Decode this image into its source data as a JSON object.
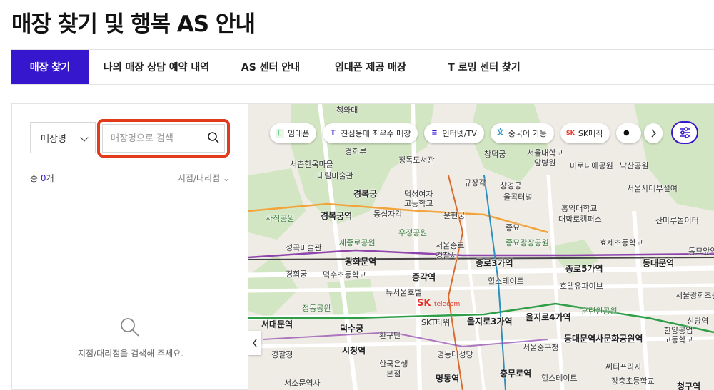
{
  "page": {
    "title": "매장 찾기 및 행복 AS 안내"
  },
  "tabs": [
    {
      "label": "매장 찾기",
      "active": true
    },
    {
      "label": "나의 매장 상담 예약 내역",
      "active": false
    },
    {
      "label": "AS 센터 안내",
      "active": false
    },
    {
      "label": "임대폰 제공 매장",
      "active": false
    },
    {
      "label": "T 로밍 센터 찾기",
      "active": false
    }
  ],
  "search": {
    "select_value": "매장명",
    "placeholder": "매장명으로 검색",
    "count_prefix": "총 ",
    "count_value": "0",
    "count_suffix": "개",
    "sort_label": "지점/대리점",
    "empty_message": "지점/대리점을 검색해 주세요."
  },
  "map": {
    "chips": [
      {
        "label": "임대폰",
        "icon": "phone-icon"
      },
      {
        "label": "진심응대 최우수 매장",
        "icon": "t-brand-icon"
      },
      {
        "label": "인터넷/TV",
        "icon": "tv-icon"
      },
      {
        "label": "중국어 가능",
        "icon": "chinese-char-icon"
      },
      {
        "label": "SK매직",
        "icon": "sk-logo-icon"
      },
      {
        "label": "",
        "icon": "apple-icon"
      }
    ],
    "skt_logo": {
      "text": "SK",
      "sub": "telecom"
    },
    "labels": [
      "청와대",
      "경희루",
      "정독도서관",
      "창덕궁",
      "서울대학교",
      "암병원",
      "마로니에공원",
      "낙산공원",
      "서촌한옥마을",
      "대림미술관",
      "경복궁",
      "덕성여자",
      "고등학교",
      "규장각",
      "율곡터널",
      "창경궁",
      "경복궁역",
      "동십자각",
      "운현궁",
      "종묘",
      "홍익대학교",
      "대학로캠퍼스",
      "사직공원",
      "우정공원",
      "세종로공원",
      "서울종로",
      "경찰서",
      "종묘광장공원",
      "효제초등학교",
      "광화문역",
      "종로3가역",
      "종로5가역",
      "동대문역",
      "성곡미술관",
      "덕수초등학교",
      "종각역",
      "힐스테이트",
      "경희궁",
      "뉴서울호텔",
      "호텔유파이브",
      "정동공원",
      "을지로3가역",
      "을지로4가역",
      "훈련원공원",
      "서대문역",
      "덕수궁",
      "SKT타워",
      "환구단",
      "동대문역사문화공원역",
      "시청역",
      "서울중구청",
      "명동대성당",
      "경찰청",
      "한국은행",
      "본점",
      "명동역",
      "충무로역",
      "힐스테이트",
      "장충초등학교",
      "청구역",
      "한양공업",
      "고등학교",
      "신당역",
      "서울사대부설여",
      "산마루놀이터",
      "동묘앞역",
      "씨티프라자",
      "서울광희초등학교",
      "서소문역사"
    ]
  }
}
